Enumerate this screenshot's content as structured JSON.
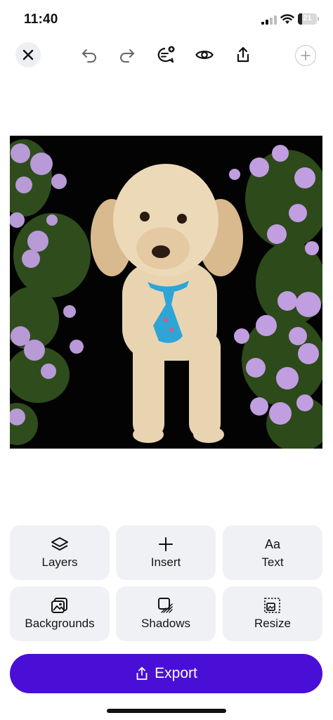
{
  "status_bar": {
    "time": "11:40",
    "battery_percent": "21",
    "battery_level": 0.21
  },
  "toolbar": {
    "icons": [
      "close-icon",
      "undo-icon",
      "redo-icon",
      "comment-add-icon",
      "preview-eye-icon",
      "share-icon",
      "add-page-icon"
    ]
  },
  "canvas": {
    "subject": "dog photo with flowers"
  },
  "tools": [
    {
      "label": "Layers",
      "icon": "layers-icon"
    },
    {
      "label": "Insert",
      "icon": "plus-icon"
    },
    {
      "label": "Text",
      "icon": "text-icon",
      "glyph": "Aa"
    },
    {
      "label": "Backgrounds",
      "icon": "backgrounds-icon"
    },
    {
      "label": "Shadows",
      "icon": "shadows-icon"
    },
    {
      "label": "Resize",
      "icon": "resize-icon"
    }
  ],
  "export": {
    "label": "Export"
  },
  "colors": {
    "accent": "#4a0fd6",
    "tile_bg": "#f0f1f4"
  }
}
